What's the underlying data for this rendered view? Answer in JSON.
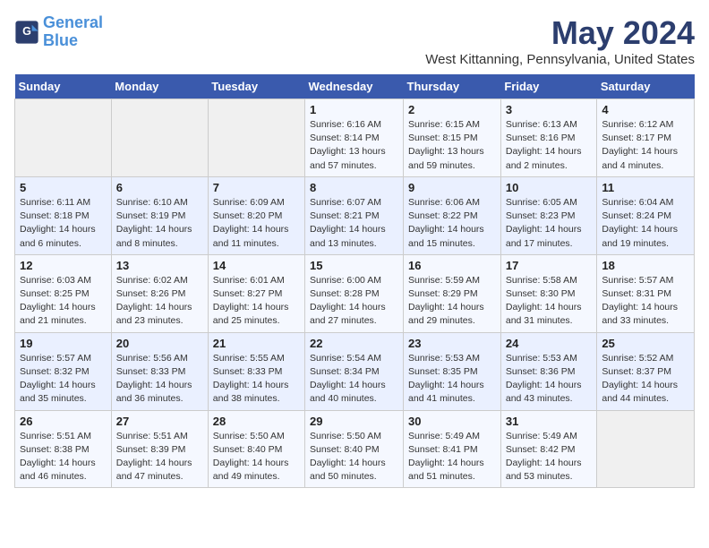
{
  "logo": {
    "line1": "General",
    "line2": "Blue"
  },
  "title": "May 2024",
  "location": "West Kittanning, Pennsylvania, United States",
  "days_of_week": [
    "Sunday",
    "Monday",
    "Tuesday",
    "Wednesday",
    "Thursday",
    "Friday",
    "Saturday"
  ],
  "weeks": [
    [
      {
        "day": "",
        "info": ""
      },
      {
        "day": "",
        "info": ""
      },
      {
        "day": "",
        "info": ""
      },
      {
        "day": "1",
        "info": "Sunrise: 6:16 AM\nSunset: 8:14 PM\nDaylight: 13 hours\nand 57 minutes."
      },
      {
        "day": "2",
        "info": "Sunrise: 6:15 AM\nSunset: 8:15 PM\nDaylight: 13 hours\nand 59 minutes."
      },
      {
        "day": "3",
        "info": "Sunrise: 6:13 AM\nSunset: 8:16 PM\nDaylight: 14 hours\nand 2 minutes."
      },
      {
        "day": "4",
        "info": "Sunrise: 6:12 AM\nSunset: 8:17 PM\nDaylight: 14 hours\nand 4 minutes."
      }
    ],
    [
      {
        "day": "5",
        "info": "Sunrise: 6:11 AM\nSunset: 8:18 PM\nDaylight: 14 hours\nand 6 minutes."
      },
      {
        "day": "6",
        "info": "Sunrise: 6:10 AM\nSunset: 8:19 PM\nDaylight: 14 hours\nand 8 minutes."
      },
      {
        "day": "7",
        "info": "Sunrise: 6:09 AM\nSunset: 8:20 PM\nDaylight: 14 hours\nand 11 minutes."
      },
      {
        "day": "8",
        "info": "Sunrise: 6:07 AM\nSunset: 8:21 PM\nDaylight: 14 hours\nand 13 minutes."
      },
      {
        "day": "9",
        "info": "Sunrise: 6:06 AM\nSunset: 8:22 PM\nDaylight: 14 hours\nand 15 minutes."
      },
      {
        "day": "10",
        "info": "Sunrise: 6:05 AM\nSunset: 8:23 PM\nDaylight: 14 hours\nand 17 minutes."
      },
      {
        "day": "11",
        "info": "Sunrise: 6:04 AM\nSunset: 8:24 PM\nDaylight: 14 hours\nand 19 minutes."
      }
    ],
    [
      {
        "day": "12",
        "info": "Sunrise: 6:03 AM\nSunset: 8:25 PM\nDaylight: 14 hours\nand 21 minutes."
      },
      {
        "day": "13",
        "info": "Sunrise: 6:02 AM\nSunset: 8:26 PM\nDaylight: 14 hours\nand 23 minutes."
      },
      {
        "day": "14",
        "info": "Sunrise: 6:01 AM\nSunset: 8:27 PM\nDaylight: 14 hours\nand 25 minutes."
      },
      {
        "day": "15",
        "info": "Sunrise: 6:00 AM\nSunset: 8:28 PM\nDaylight: 14 hours\nand 27 minutes."
      },
      {
        "day": "16",
        "info": "Sunrise: 5:59 AM\nSunset: 8:29 PM\nDaylight: 14 hours\nand 29 minutes."
      },
      {
        "day": "17",
        "info": "Sunrise: 5:58 AM\nSunset: 8:30 PM\nDaylight: 14 hours\nand 31 minutes."
      },
      {
        "day": "18",
        "info": "Sunrise: 5:57 AM\nSunset: 8:31 PM\nDaylight: 14 hours\nand 33 minutes."
      }
    ],
    [
      {
        "day": "19",
        "info": "Sunrise: 5:57 AM\nSunset: 8:32 PM\nDaylight: 14 hours\nand 35 minutes."
      },
      {
        "day": "20",
        "info": "Sunrise: 5:56 AM\nSunset: 8:33 PM\nDaylight: 14 hours\nand 36 minutes."
      },
      {
        "day": "21",
        "info": "Sunrise: 5:55 AM\nSunset: 8:33 PM\nDaylight: 14 hours\nand 38 minutes."
      },
      {
        "day": "22",
        "info": "Sunrise: 5:54 AM\nSunset: 8:34 PM\nDaylight: 14 hours\nand 40 minutes."
      },
      {
        "day": "23",
        "info": "Sunrise: 5:53 AM\nSunset: 8:35 PM\nDaylight: 14 hours\nand 41 minutes."
      },
      {
        "day": "24",
        "info": "Sunrise: 5:53 AM\nSunset: 8:36 PM\nDaylight: 14 hours\nand 43 minutes."
      },
      {
        "day": "25",
        "info": "Sunrise: 5:52 AM\nSunset: 8:37 PM\nDaylight: 14 hours\nand 44 minutes."
      }
    ],
    [
      {
        "day": "26",
        "info": "Sunrise: 5:51 AM\nSunset: 8:38 PM\nDaylight: 14 hours\nand 46 minutes."
      },
      {
        "day": "27",
        "info": "Sunrise: 5:51 AM\nSunset: 8:39 PM\nDaylight: 14 hours\nand 47 minutes."
      },
      {
        "day": "28",
        "info": "Sunrise: 5:50 AM\nSunset: 8:40 PM\nDaylight: 14 hours\nand 49 minutes."
      },
      {
        "day": "29",
        "info": "Sunrise: 5:50 AM\nSunset: 8:40 PM\nDaylight: 14 hours\nand 50 minutes."
      },
      {
        "day": "30",
        "info": "Sunrise: 5:49 AM\nSunset: 8:41 PM\nDaylight: 14 hours\nand 51 minutes."
      },
      {
        "day": "31",
        "info": "Sunrise: 5:49 AM\nSunset: 8:42 PM\nDaylight: 14 hours\nand 53 minutes."
      },
      {
        "day": "",
        "info": ""
      }
    ]
  ]
}
